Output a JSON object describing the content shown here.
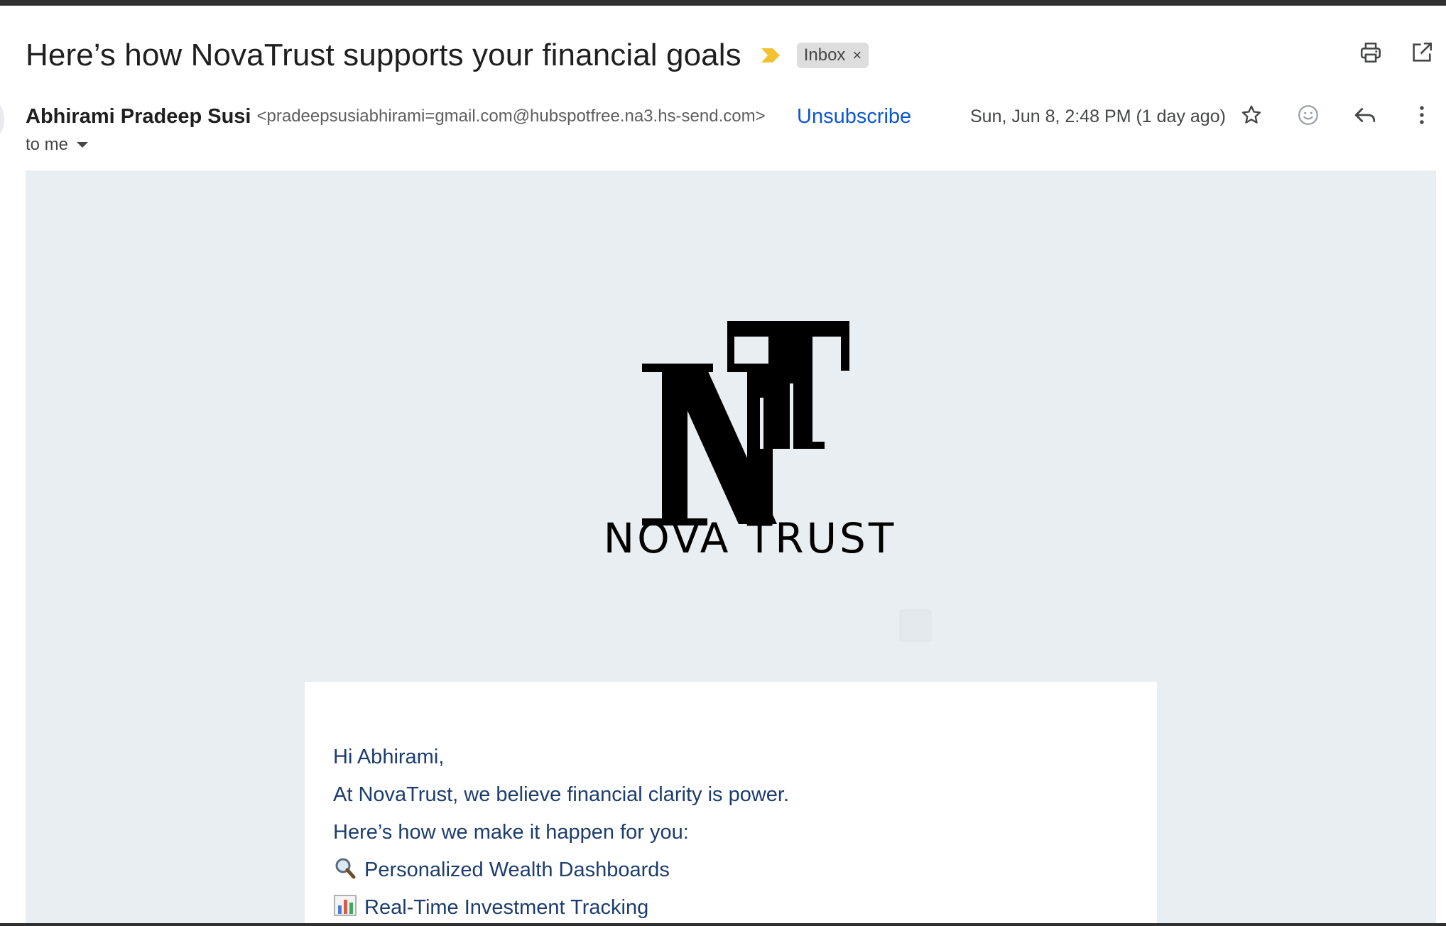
{
  "email": {
    "subject": "Here’s how NovaTrust supports your financial goals",
    "label": "Inbox",
    "label_remove": "×",
    "sender_name": "Abhirami Pradeep Susi",
    "sender_email": "<pradeepsusiabhirami=gmail.com@hubspotfree.na3.hs-send.com>",
    "unsubscribe": "Unsubscribe",
    "date": "Sun, Jun 8, 2:48 PM (1 day ago)",
    "recipient": "to me"
  },
  "icons": {
    "importance": "importance-marker-icon",
    "print": "print-icon",
    "new_window": "open-in-new-window-icon",
    "star": "star-icon",
    "emoji": "add-reaction-icon",
    "reply": "reply-icon",
    "more": "more-vert-icon",
    "caret": "chevron-down-icon"
  },
  "colors": {
    "importance": "#f1c232",
    "link": "#0b57d0",
    "body_bg": "#e9eef2",
    "body_text": "#1c3d6e"
  },
  "body": {
    "logo_text": "NOVA TRUST",
    "lines": [
      "Hi Abhirami,",
      "At NovaTrust, we believe financial clarity is power.",
      "Here’s how we make it happen for you:",
      "Personalized Wealth Dashboards",
      "Real-Time Investment Tracking"
    ],
    "line_icons": [
      "magnifying-glass-emoji",
      "bar-chart-emoji"
    ]
  }
}
